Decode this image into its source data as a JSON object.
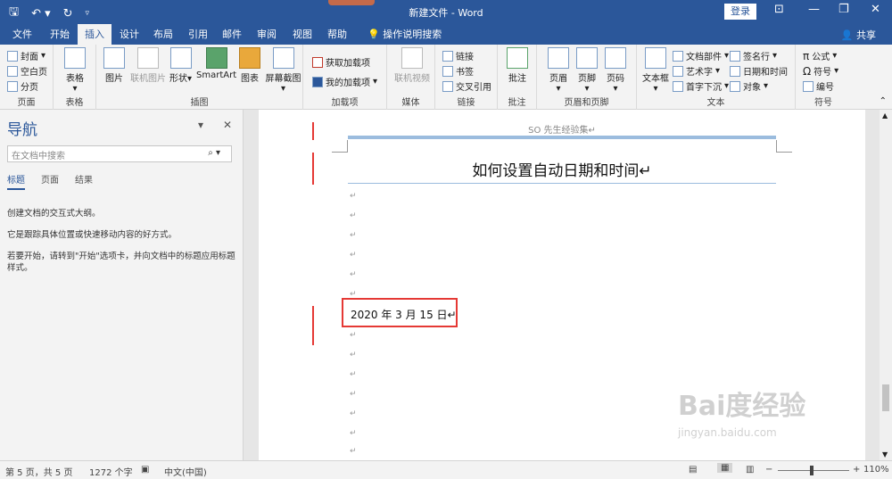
{
  "titlebar": {
    "doc_title": "新建文件  -  Word",
    "login": "登录",
    "qat": [
      "save-icon",
      "undo-icon",
      "redo-icon",
      "customize-icon"
    ]
  },
  "tabs": [
    "文件",
    "开始",
    "插入",
    "设计",
    "布局",
    "引用",
    "邮件",
    "审阅",
    "视图",
    "帮助",
    "操作说明搜索"
  ],
  "active_tab": "插入",
  "share": "共享",
  "ribbon": {
    "pages": {
      "label": "页面",
      "cover": "封面",
      "blank": "空白页",
      "break": "分页"
    },
    "table": {
      "label": "表格",
      "btn": "表格"
    },
    "illustrations": {
      "label": "插图",
      "picture": "图片",
      "online_picture": "联机图片",
      "shapes": "形状",
      "smartart": "SmartArt",
      "chart": "图表",
      "screenshot": "屏幕截图"
    },
    "addins": {
      "label": "加载项",
      "get": "获取加载项",
      "mine": "我的加载项"
    },
    "media": {
      "label": "媒体",
      "online_video": "联机视频"
    },
    "links": {
      "label": "链接",
      "link": "链接",
      "bookmark": "书签",
      "crossref": "交叉引用"
    },
    "comments": {
      "label": "批注",
      "comment": "批注"
    },
    "header_footer": {
      "label": "页眉和页脚",
      "header": "页眉",
      "footer": "页脚",
      "page_num": "页码"
    },
    "text": {
      "label": "文本",
      "textbox": "文本框",
      "quickparts": "文档部件",
      "wordart": "艺术字",
      "dropcap": "首字下沉",
      "signature": "签名行",
      "datetime": "日期和时间",
      "object": "对象"
    },
    "symbols": {
      "label": "符号",
      "equation": "公式",
      "symbol": "符号",
      "number": "编号"
    }
  },
  "nav": {
    "title": "导航",
    "search_placeholder": "在文档中搜索",
    "tabs": [
      "标题",
      "页面",
      "结果"
    ],
    "p1": "创建文档的交互式大纲。",
    "p2": "它是跟踪具体位置或快速移动内容的好方式。",
    "p3": "若要开始，请转到\"开始\"选项卡，并向文档中的标题应用标题样式。"
  },
  "doc": {
    "header_text": "SO 先生经验集↵",
    "title": "如何设置自动日期和时间↵",
    "para_mark": "↵",
    "date_text": "2020 年 3 月 15 日↵"
  },
  "watermark": {
    "brand": "Bai度经验",
    "url": "jingyan.baidu.com"
  },
  "status": {
    "page": "第 5 页，共 5 页",
    "words": "1272 个字",
    "lang": "中文(中国)",
    "zoom": "110%"
  }
}
